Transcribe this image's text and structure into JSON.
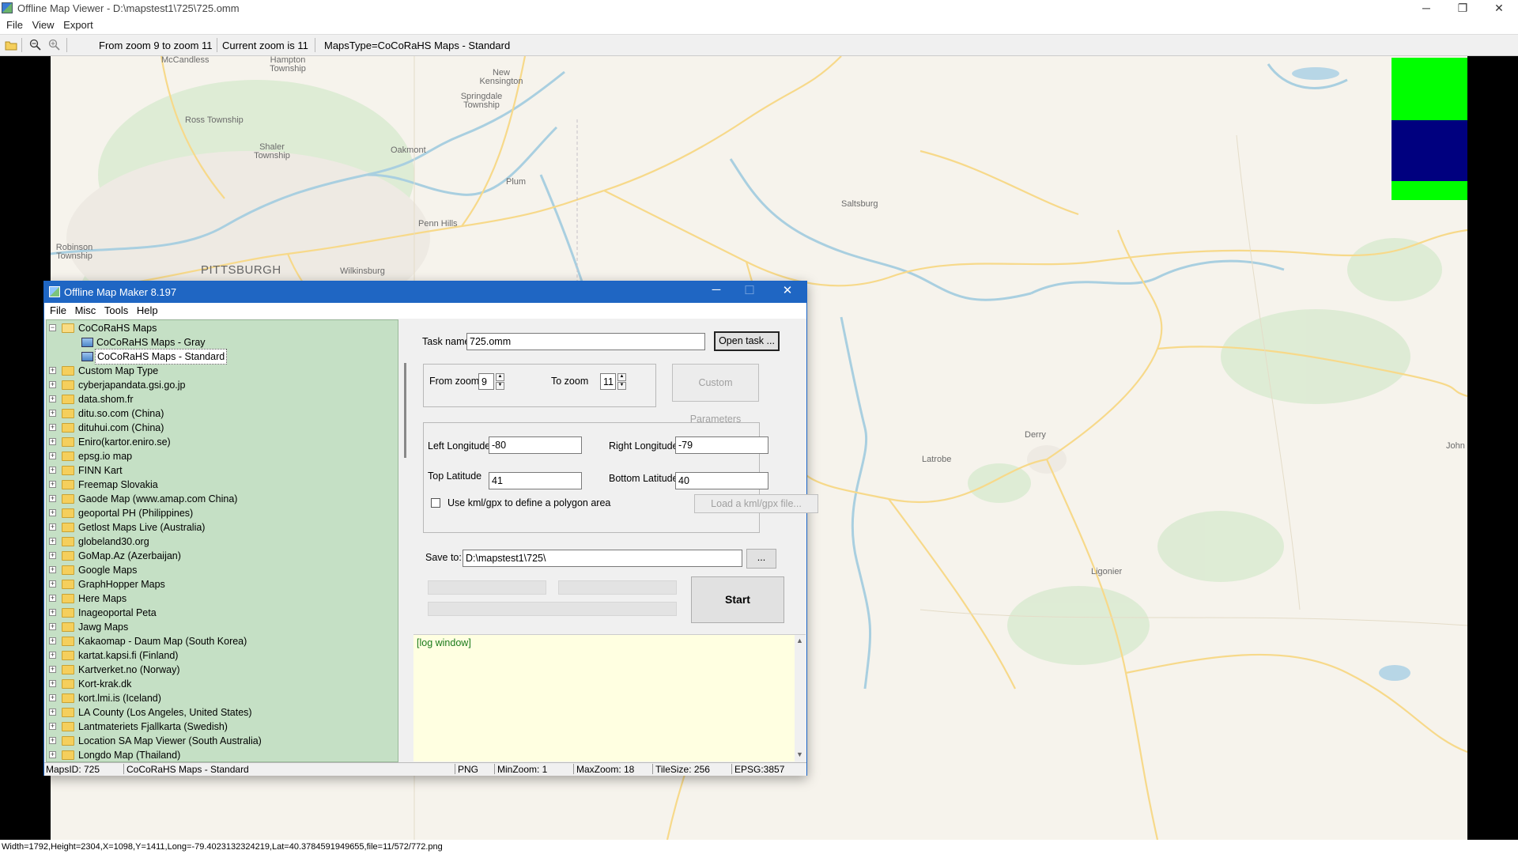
{
  "viewer": {
    "title": "Offline Map Viewer - D:\\mapstest1\\725\\725.omm",
    "controls": {
      "minimize": "─",
      "restore": "❐",
      "close": "✕"
    },
    "menu": [
      "File",
      "View",
      "Export"
    ],
    "toolbar": {
      "icons": [
        "open-folder-icon",
        "zoom-out-icon",
        "zoom-in-icon"
      ],
      "zoom_range": "From zoom 9 to zoom 11",
      "current_zoom": "Current zoom is 11",
      "maps_type": "MapsType=CoCoRaHS Maps - Standard"
    },
    "status": "Width=1792,Height=2304,X=1098,Y=1411,Long=-79.4023132324219,Lat=40.3784591949655,file=11/572/772.png"
  },
  "map": {
    "labels": {
      "mccandless": "McCandless",
      "hampton": "Hampton Township",
      "new_kensington": "New Kensington",
      "springdale": "Springdale Township",
      "ross": "Ross Township",
      "shaler": "Shaler Township",
      "oakmont": "Oakmont",
      "plum": "Plum",
      "saltsburg": "Saltsburg",
      "penn_hills": "Penn Hills",
      "robinson": "Robinson Township",
      "pittsburgh": "PITTSBURGH",
      "wilkinsburg": "Wilkinsburg",
      "derry": "Derry",
      "latrobe": "Latrobe",
      "ligonier": "Ligonier",
      "john": "John"
    },
    "colors": {
      "overlay_green": "#00ff00",
      "overlay_navy": "#00007f",
      "background": "#f6f3ec"
    }
  },
  "dialog": {
    "title": "Offline Map Maker 8.197",
    "controls": {
      "minimize": "─",
      "maximize": "☐",
      "close": "✕"
    },
    "menu": [
      "File",
      "Misc",
      "Tools",
      "Help"
    ],
    "tree": {
      "root": "CoCoRaHS Maps",
      "children": [
        "CoCoRaHS Maps - Gray",
        "CoCoRaHS Maps - Standard"
      ],
      "selected_child": "CoCoRaHS Maps - Standard",
      "folders": [
        "Custom Map Type",
        "cyberjapandata.gsi.go.jp",
        "data.shom.fr",
        "ditu.so.com (China)",
        "dituhui.com (China)",
        "Eniro(kartor.eniro.se)",
        "epsg.io map",
        "FINN Kart",
        "Freemap Slovakia",
        "Gaode Map (www.amap.com China)",
        "geoportal PH (Philippines)",
        "Getlost Maps Live (Australia)",
        "globeland30.org",
        "GoMap.Az (Azerbaijan)",
        "Google Maps",
        "GraphHopper Maps",
        "Here Maps",
        "Inageoportal Peta",
        "Jawg Maps",
        "Kakaomap - Daum Map (South Korea)",
        "kartat.kapsi.fi (Finland)",
        "Kartverket.no (Norway)",
        "Kort-krak.dk",
        "kort.lmi.is (Iceland)",
        "LA County (Los Angeles, United States)",
        "Lantmateriets Fjallkarta (Swedish)",
        "Location SA Map Viewer (South Australia)",
        "Longdo Map (Thailand)"
      ]
    },
    "form": {
      "task_name_label": "Task name",
      "task_name_value": "725.omm",
      "open_task_button": "Open task ...",
      "from_zoom_label": "From zoom",
      "from_zoom_value": "9",
      "to_zoom_label": "To zoom",
      "to_zoom_value": "11",
      "custom_params_button": "Custom Parameters",
      "left_lon_label": "Left Longitude",
      "left_lon_value": "-80",
      "right_lon_label": "Right Longitude",
      "right_lon_value": "-79",
      "top_lat_label": "Top Latitude",
      "top_lat_value": "41",
      "bottom_lat_label": "Bottom Latitude",
      "bottom_lat_value": "40",
      "kml_checkbox_label": "Use kml/gpx to define a polygon area",
      "load_kml_button": "Load a kml/gpx file...",
      "save_to_label": "Save to:",
      "save_to_value": "D:\\mapstest1\\725\\",
      "browse_button": "...",
      "start_button": "Start",
      "log_text": "[log window]"
    },
    "status": {
      "maps_id": "MapsID: 725",
      "map_name": "CoCoRaHS Maps - Standard",
      "format": "PNG",
      "min_zoom": "MinZoom: 1",
      "max_zoom": "MaxZoom: 18",
      "tile_size": "TileSize: 256",
      "epsg": "EPSG:3857"
    }
  }
}
